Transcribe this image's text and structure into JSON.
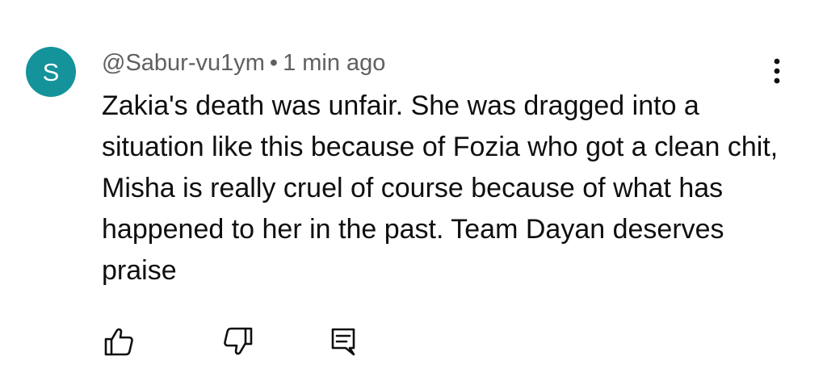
{
  "comment": {
    "avatar_initial": "S",
    "avatar_color": "#14939b",
    "author": "@Sabur-vu1ym",
    "separator": "•",
    "timestamp": "1 min ago",
    "text": "Zakia's death was unfair. She was dragged into a situation like this because of Fozia who got a clean chit, Misha is really cruel of course because of what has happened to her in the past. Team Dayan deserves praise"
  },
  "icons": {
    "menu": "more-vertical-icon",
    "like": "thumbs-up-icon",
    "dislike": "thumbs-down-icon",
    "reply": "reply-comment-icon"
  },
  "colors": {
    "primary_text": "#0f0f0f",
    "secondary_text": "#606060",
    "background": "#ffffff"
  }
}
